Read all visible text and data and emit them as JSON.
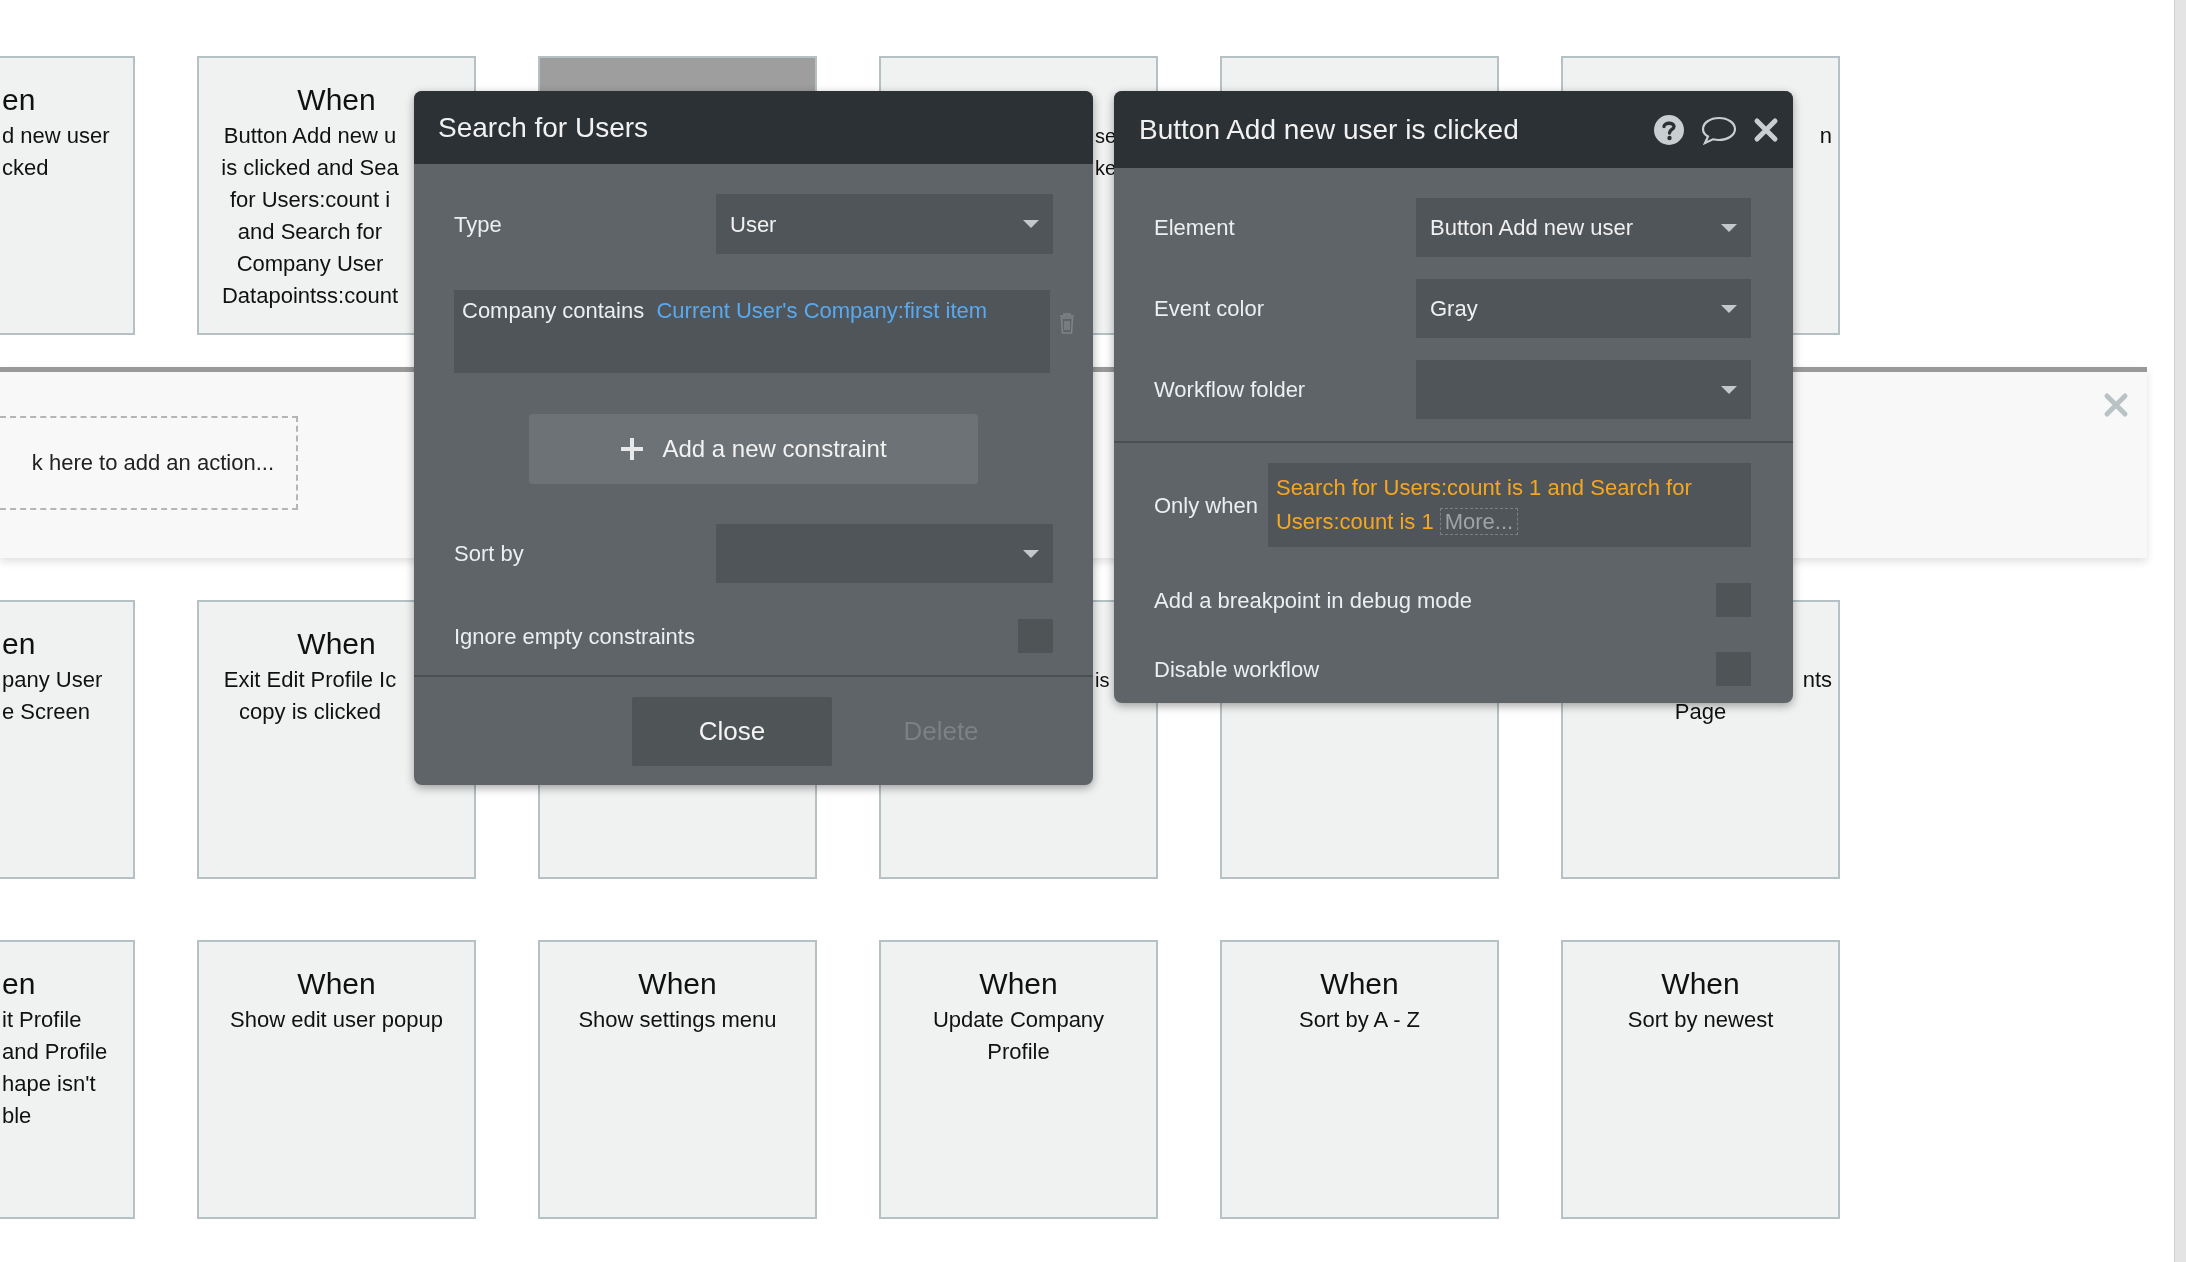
{
  "canvas_rows": [
    {
      "cards": [
        {
          "kind": "cut",
          "title": "en",
          "lines": [
            {
              "text": "d new user",
              "kind": "centered"
            },
            {
              "text": "cked",
              "kind": "centered"
            }
          ],
          "selected": false
        },
        {
          "kind": "covered-right",
          "title": "When",
          "lines": [
            {
              "text": "Button Add new u",
              "kind": "centered"
            },
            {
              "text": "is clicked and Sea",
              "kind": "centered"
            },
            {
              "text": "for Users:count i",
              "kind": "centered"
            },
            {
              "text": "and Search for",
              "kind": "centered"
            },
            {
              "text": "Company User",
              "kind": "centered"
            },
            {
              "text": "Datapointss:count",
              "kind": "centered"
            }
          ],
          "selected": false
        },
        {
          "kind": "covered",
          "selected": true
        },
        {
          "kind": "gap",
          "lines": [
            {
              "text": "se",
              "kind": "peek-left"
            },
            {
              "text": "ke",
              "kind": "peek-left"
            }
          ],
          "selected": false
        },
        {
          "kind": "covered",
          "selected": false
        },
        {
          "kind": "full",
          "lines": [
            {
              "text": "n",
              "kind": "peek-right"
            }
          ],
          "selected": false
        }
      ]
    },
    {
      "cards": [
        {
          "kind": "cut",
          "title": "en",
          "lines": [
            {
              "text": "pany User",
              "kind": "centered"
            },
            {
              "text": "e Screen",
              "kind": "centered"
            }
          ],
          "selected": false
        },
        {
          "kind": "covered-right",
          "title": "When",
          "lines": [
            {
              "text": "Exit Edit Profile Ic",
              "kind": "centered"
            },
            {
              "text": "copy is clicked",
              "kind": "centered"
            }
          ],
          "selected": false
        },
        {
          "kind": "covered",
          "selected": false
        },
        {
          "kind": "gap",
          "lines": [
            {
              "text": "is",
              "kind": "peek-left"
            }
          ],
          "selected": false
        },
        {
          "kind": "covered",
          "selected": false
        },
        {
          "kind": "full",
          "lines": [
            {
              "text": "nts",
              "kind": "peek-right"
            },
            {
              "text": "Page",
              "kind": "centered"
            }
          ],
          "selected": false
        }
      ]
    },
    {
      "cards": [
        {
          "kind": "cut",
          "title": "en",
          "lines": [
            {
              "text": "it Profile",
              "kind": "centered"
            },
            {
              "text": "and Profile",
              "kind": "centered"
            },
            {
              "text": "hape isn't",
              "kind": "centered"
            },
            {
              "text": "ble",
              "kind": "centered"
            }
          ],
          "selected": false
        },
        {
          "kind": "full",
          "title": "When",
          "lines": [
            {
              "text": "Show edit user popup",
              "kind": "centered"
            }
          ],
          "selected": false
        },
        {
          "kind": "full",
          "title": "When",
          "lines": [
            {
              "text": "Show settings menu",
              "kind": "centered"
            }
          ],
          "selected": false
        },
        {
          "kind": "full",
          "title": "When",
          "lines": [
            {
              "text": "Update Company",
              "kind": "centered"
            },
            {
              "text": "Profile",
              "kind": "centered"
            }
          ],
          "selected": false
        },
        {
          "kind": "full",
          "title": "When",
          "lines": [
            {
              "text": "Sort by A - Z",
              "kind": "centered"
            }
          ],
          "selected": false
        },
        {
          "kind": "full",
          "title": "When",
          "lines": [
            {
              "text": "Sort by newest",
              "kind": "centered"
            }
          ],
          "selected": false
        }
      ]
    }
  ],
  "action_strip": {
    "prompt": "k here to add an action..."
  },
  "search_panel": {
    "title": "Search for Users",
    "type_label": "Type",
    "type_value": "User",
    "constraint": {
      "field": "Company contains",
      "value": "Current User's Company:first item"
    },
    "add_button": "Add a new constraint",
    "sort_label": "Sort by",
    "ignore_label": "Ignore empty constraints",
    "ignore_checked": false,
    "buttons": [
      {
        "label": "Close",
        "disabled": false
      },
      {
        "label": "Delete",
        "disabled": true
      }
    ]
  },
  "event_panel": {
    "title": "Button Add new user is clicked",
    "fields": [
      {
        "label": "Element",
        "value": "Button Add new user"
      },
      {
        "label": "Event color",
        "value": "Gray"
      },
      {
        "label": "Workflow folder"
      }
    ],
    "only_when": {
      "label": "Only when",
      "expression": "Search for Users:count is 1 and Search for Users:count is 1",
      "more": "More..."
    },
    "options": [
      {
        "label": "Add a breakpoint in debug mode",
        "checked": false
      },
      {
        "label": "Disable workflow",
        "checked": false
      }
    ]
  }
}
